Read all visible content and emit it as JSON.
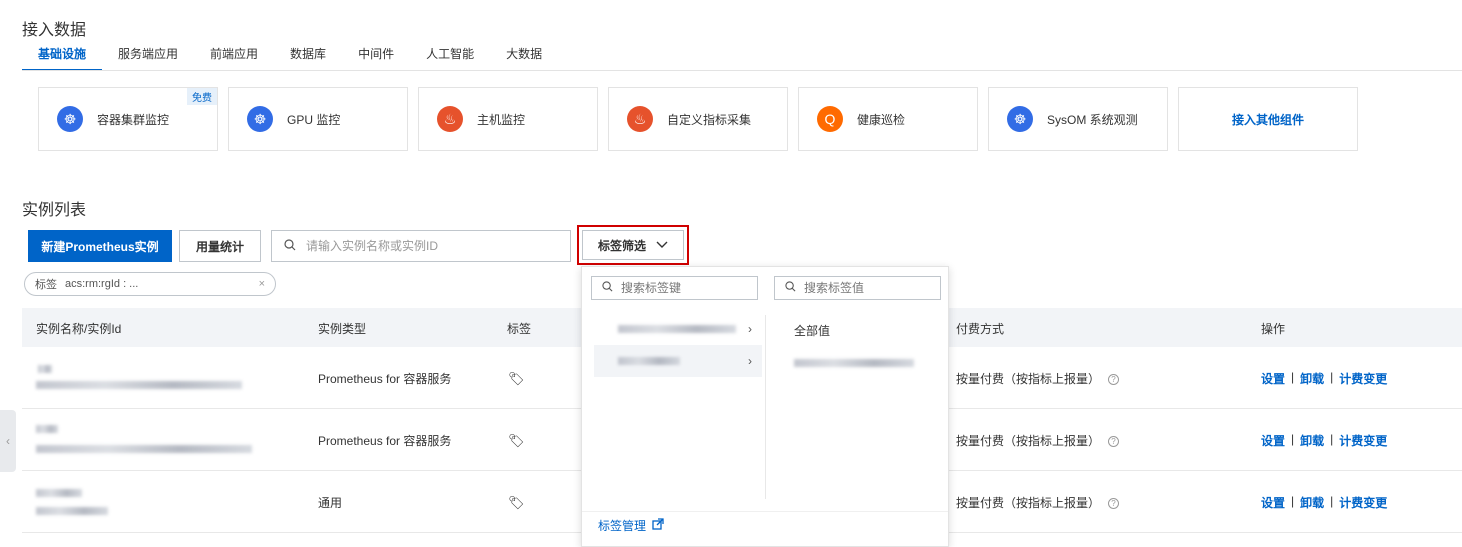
{
  "section1": {
    "title": "接入数据"
  },
  "tabs": [
    "基础设施",
    "服务端应用",
    "前端应用",
    "数据库",
    "中间件",
    "人工智能",
    "大数据"
  ],
  "cards": [
    {
      "label": "容器集群监控",
      "icon": "kubernetes-icon",
      "badge": "免费"
    },
    {
      "label": "GPU 监控",
      "icon": "kubernetes-icon"
    },
    {
      "label": "主机监控",
      "icon": "prometheus-icon"
    },
    {
      "label": "自定义指标采集",
      "icon": "prometheus-icon"
    },
    {
      "label": "健康巡检",
      "icon": "inspection-icon"
    },
    {
      "label": "SysOM 系统观测",
      "icon": "kubernetes-icon"
    },
    {
      "label": "接入其他组件"
    }
  ],
  "section2": {
    "title": "实例列表"
  },
  "toolbar": {
    "create_label": "新建Prometheus实例",
    "usage_label": "用量统计",
    "search_placeholder": "请输入实例名称或实例ID",
    "tag_filter_label": "标签筛选"
  },
  "chip": {
    "label": "标签",
    "value": "acs:rm:rgId : ...",
    "close": "×"
  },
  "table": {
    "headers": [
      "实例名称/实例Id",
      "实例类型",
      "标签",
      "付费方式",
      "操作"
    ],
    "rows": [
      {
        "type": "Prometheus for 容器服务",
        "billing": "按量付费（按指标上报量）"
      },
      {
        "type": "Prometheus for 容器服务",
        "billing": "按量付费（按指标上报量）"
      },
      {
        "type": "通用",
        "billing": "按量付费（按指标上报量）"
      }
    ],
    "ops": {
      "settings": "设置",
      "uninstall": "卸载",
      "billing_change": "计费变更"
    }
  },
  "dropdown": {
    "key_placeholder": "搜索标签键",
    "value_placeholder": "搜索标签值",
    "all_values": "全部值",
    "footer": "标签管理"
  },
  "colors": {
    "primary": "#0064c8",
    "highlight": "#d00000"
  }
}
